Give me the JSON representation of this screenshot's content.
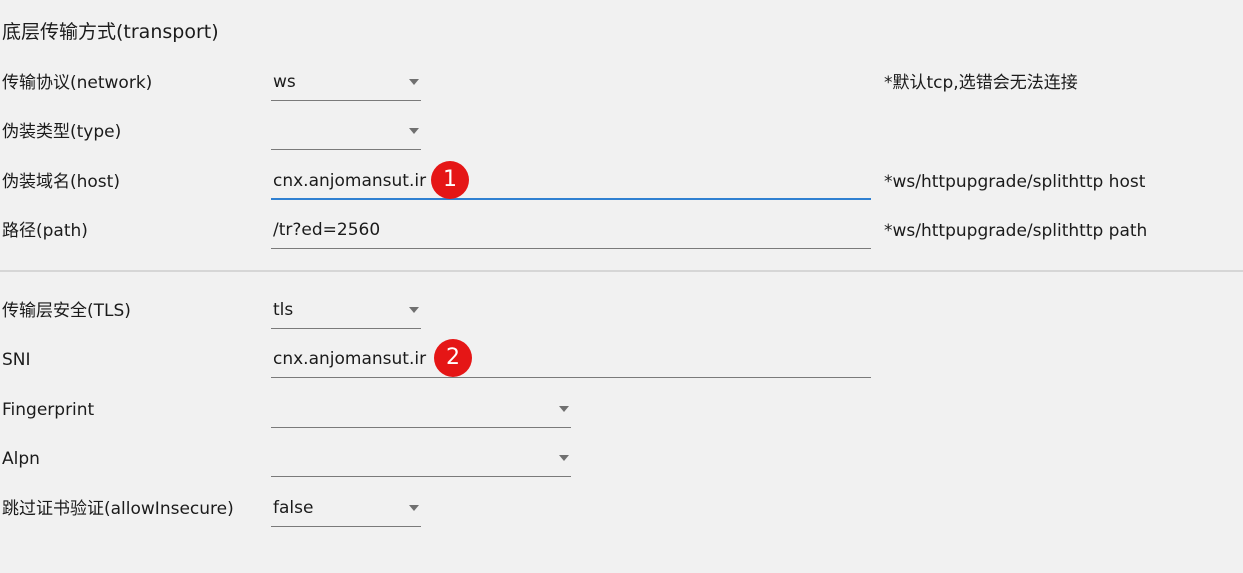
{
  "transport": {
    "title": "底层传输方式(transport)",
    "network": {
      "label": "传输协议(network)",
      "value": "ws",
      "hint": "*默认tcp,选错会无法连接"
    },
    "type": {
      "label": "伪装类型(type)",
      "value": ""
    },
    "host": {
      "label": "伪装域名(host)",
      "value": "cnx.anjomansut.ir",
      "hint": "*ws/httpupgrade/splithttp host",
      "marker": "1"
    },
    "path": {
      "label": "路径(path)",
      "value": "/tr?ed=2560",
      "hint": "*ws/httpupgrade/splithttp path"
    }
  },
  "tls": {
    "security": {
      "label": "传输层安全(TLS)",
      "value": "tls"
    },
    "sni": {
      "label": "SNI",
      "value": "cnx.anjomansut.ir",
      "marker": "2"
    },
    "fingerprint": {
      "label": "Fingerprint",
      "value": ""
    },
    "alpn": {
      "label": "Alpn",
      "value": ""
    },
    "allow_insecure": {
      "label": "跳过证书验证(allowInsecure)",
      "value": "false"
    }
  },
  "colors": {
    "background": "#f1f1f1",
    "focus_underline": "#2f80d1",
    "marker": "#e51616"
  }
}
